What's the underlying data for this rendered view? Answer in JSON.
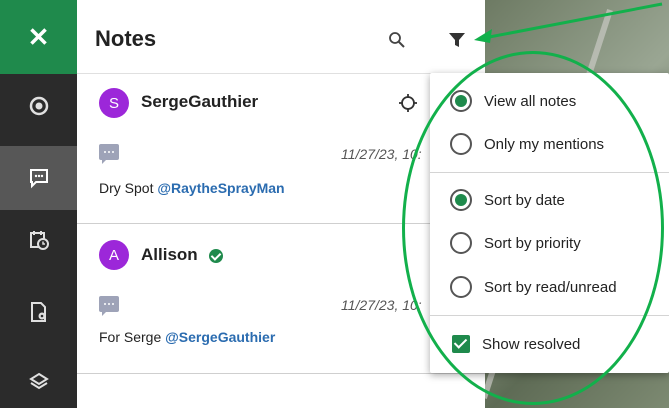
{
  "rail": {
    "close_icon": "close-icon",
    "items": [
      {
        "icon": "target-icon"
      },
      {
        "icon": "comment-icon",
        "active": true
      },
      {
        "icon": "calendar-clock-icon"
      },
      {
        "icon": "file-location-icon"
      },
      {
        "icon": "layers-icon"
      }
    ],
    "colors": {
      "accent": "#1f8a4c",
      "rail": "#2b2b2b",
      "active": "#575757"
    }
  },
  "header": {
    "title": "Notes",
    "search_icon": "search-icon",
    "filter_icon": "filter-icon"
  },
  "notes": [
    {
      "avatar_letter": "S",
      "author": "SergeGauthier",
      "verified": false,
      "timestamp": "11/27/23, 10:",
      "text": "Dry Spot ",
      "mention": "@RaytheSprayMan"
    },
    {
      "avatar_letter": "A",
      "author": "Allison",
      "verified": true,
      "timestamp": "11/27/23, 10:",
      "text": "For Serge ",
      "mention": "@SergeGauthier"
    }
  ],
  "filter_menu": {
    "view_group": [
      {
        "label": "View all notes",
        "checked": true
      },
      {
        "label": "Only my mentions",
        "checked": false
      }
    ],
    "sort_group": [
      {
        "label": "Sort by date",
        "checked": true
      },
      {
        "label": "Sort by priority",
        "checked": false
      },
      {
        "label": "Sort by read/unread",
        "checked": false
      }
    ],
    "show_resolved": {
      "label": "Show resolved",
      "checked": true
    }
  },
  "annotation": {
    "color": "#12b04b"
  }
}
